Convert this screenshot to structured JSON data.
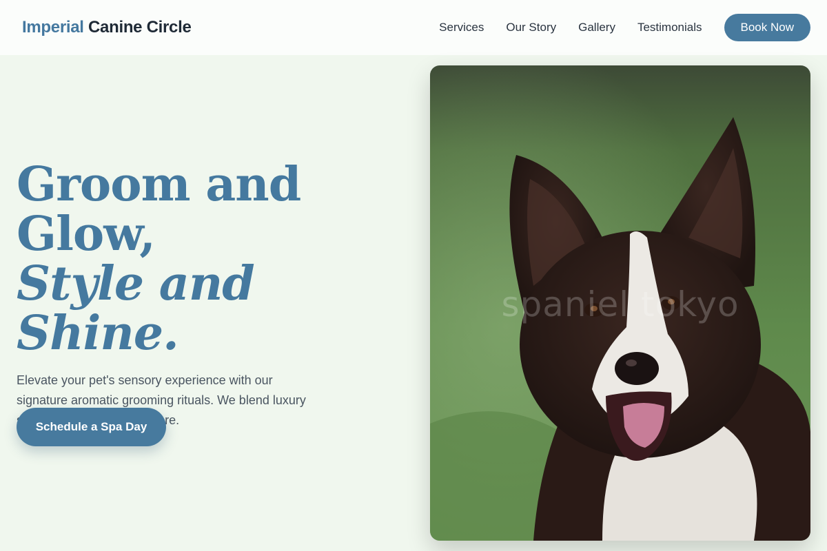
{
  "header": {
    "logo_accent": "Imperial",
    "logo_rest": "Canine Circle",
    "nav": [
      "Services",
      "Our Story",
      "Gallery",
      "Testimonials"
    ],
    "book_label": "Book Now"
  },
  "hero": {
    "headline_line1": "Groom and",
    "headline_line2": "Glow,",
    "headline_line3": "Style and Shine.",
    "subtext": "Elevate your pet's sensory experience with our signature aromatic grooming rituals. We blend luxury scents with professional care.",
    "cta_label": "Schedule a Spa Day",
    "image_watermark": "spaniel tokyo"
  },
  "colors": {
    "accent": "#477a9e",
    "background": "#f0f7ee",
    "header_bg": "#fbfdfb"
  }
}
